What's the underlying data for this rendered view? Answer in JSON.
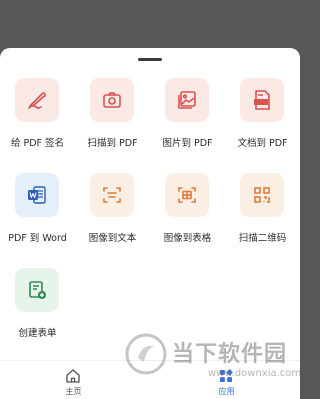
{
  "tools": [
    {
      "label": "给 PDF 签名",
      "icon": "signature-icon"
    },
    {
      "label": "扫描到 PDF",
      "icon": "camera-icon"
    },
    {
      "label": "图片到 PDF",
      "icon": "image-icon"
    },
    {
      "label": "文档到 PDF",
      "icon": "document-pdf-icon"
    },
    {
      "label": "PDF 到 Word",
      "icon": "word-icon"
    },
    {
      "label": "图像到文本",
      "icon": "scan-text-icon"
    },
    {
      "label": "图像到表格",
      "icon": "scan-table-icon"
    },
    {
      "label": "扫描二维码",
      "icon": "qr-code-icon"
    },
    {
      "label": "创建表单",
      "icon": "form-icon"
    }
  ],
  "bottom_nav": {
    "home_label": "主页",
    "apps_label": "应用",
    "active": "应用"
  },
  "watermark": {
    "title": "当下软件园",
    "url": "www.downxia.com"
  },
  "colors": {
    "accent": "#3a6fd8",
    "red_icon": "#d9534f",
    "orange_icon": "#e07b39",
    "word_blue": "#2b5fb8",
    "form_green": "#2e8b57"
  }
}
